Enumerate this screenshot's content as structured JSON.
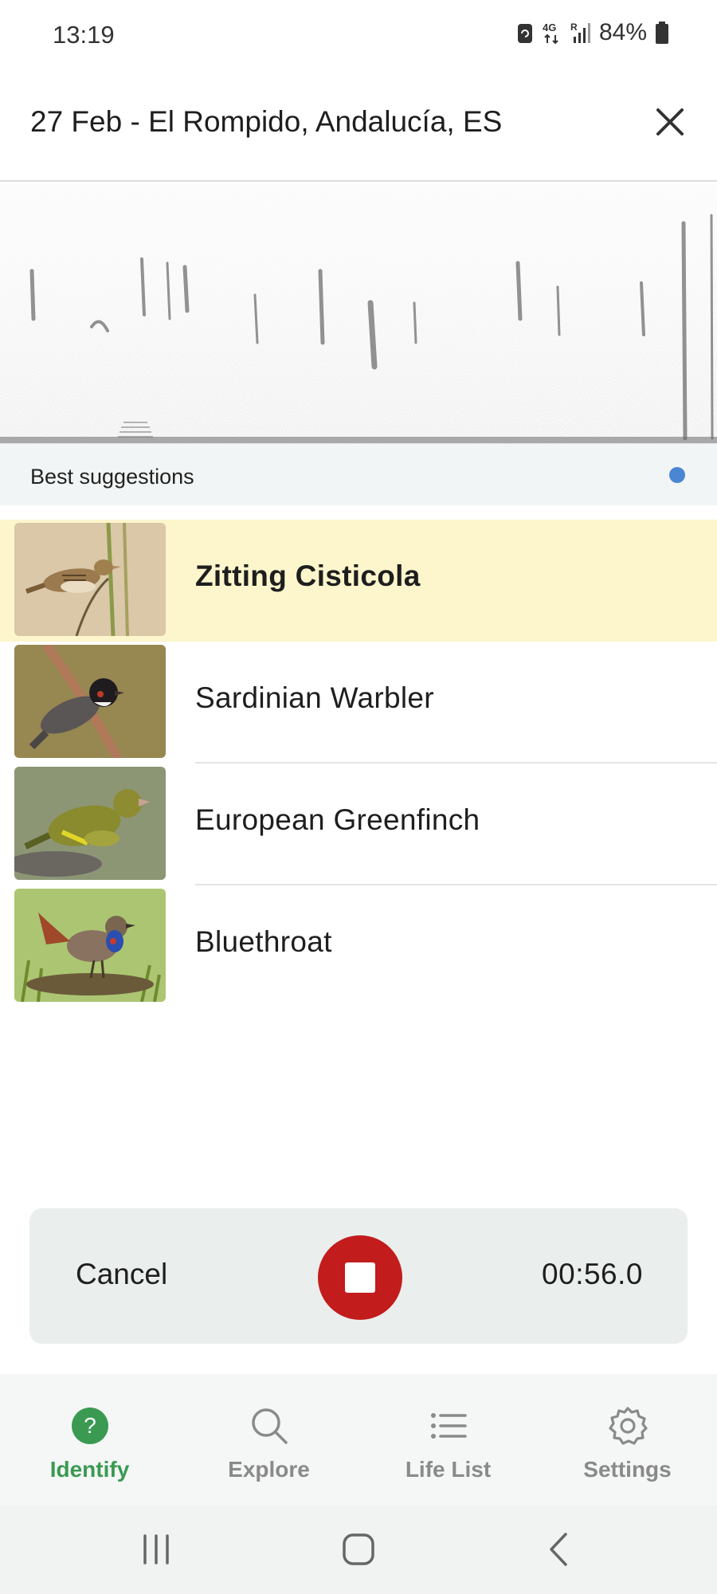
{
  "status_bar": {
    "time": "13:19",
    "network": "4G",
    "roaming": "R",
    "battery": "84%",
    "icons": [
      "sync-icon",
      "network-4g-icon",
      "signal-icon",
      "battery-icon"
    ]
  },
  "header": {
    "title": "27 Feb - El Rompido, Andalucía, ES",
    "close_icon": "close-icon"
  },
  "suggestions": {
    "label": "Best suggestions",
    "indicator_color": "#4a86d4"
  },
  "species": [
    {
      "name": "Zitting Cisticola",
      "highlighted": true,
      "thumb": "bird-photo-zitting-cisticola"
    },
    {
      "name": "Sardinian Warbler",
      "highlighted": false,
      "thumb": "bird-photo-sardinian-warbler"
    },
    {
      "name": "European Greenfinch",
      "highlighted": false,
      "thumb": "bird-photo-european-greenfinch"
    },
    {
      "name": "Bluethroat",
      "highlighted": false,
      "thumb": "bird-photo-bluethroat"
    }
  ],
  "recording": {
    "cancel_label": "Cancel",
    "timer": "00:56.0",
    "stop_icon": "stop-icon",
    "stop_color": "#c21c1c"
  },
  "nav": {
    "items": [
      {
        "label": "Identify",
        "icon": "question-circle-icon",
        "active": true
      },
      {
        "label": "Explore",
        "icon": "search-icon",
        "active": false
      },
      {
        "label": "Life List",
        "icon": "list-icon",
        "active": false
      },
      {
        "label": "Settings",
        "icon": "gear-icon",
        "active": false
      }
    ],
    "active_color": "#3a9a52"
  },
  "system_nav": {
    "buttons": [
      "recent-apps-icon",
      "home-icon",
      "back-icon"
    ]
  }
}
